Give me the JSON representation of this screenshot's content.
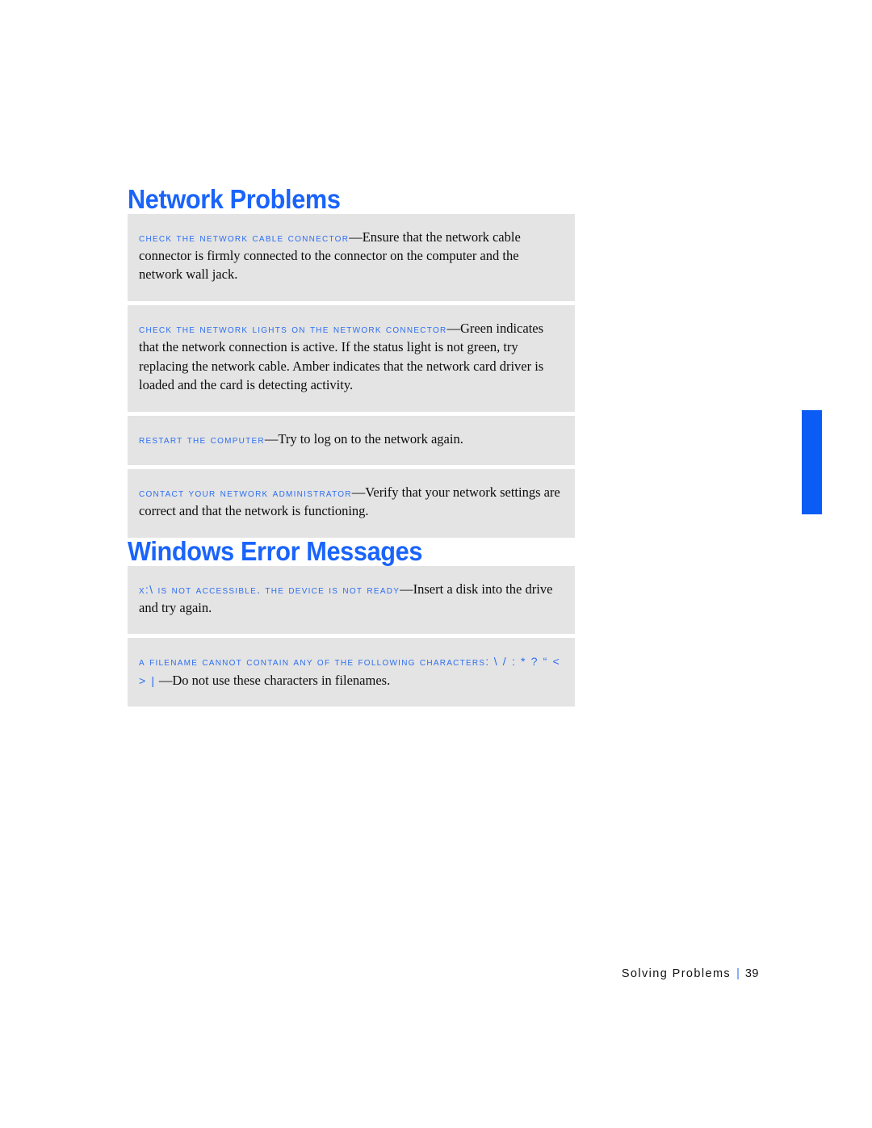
{
  "page": {
    "footer_section": "Solving Problems",
    "footer_separator": "|",
    "page_number": "39",
    "accent_color": "#1a64fb",
    "lead_color": "#2d6ef0",
    "box_color": "#e4e4e4",
    "tab_color": "#0a5cf5"
  },
  "sections": [
    {
      "heading": "Network Problems",
      "tips": [
        {
          "lead": "CHECK THE NETWORK CABLE CONNECTOR",
          "dash": "—",
          "body": "Ensure that the network cable connector is firmly connected to the connector on the computer and the network wall jack."
        },
        {
          "lead": "CHECK THE NETWORK LIGHTS ON THE NETWORK CONNECTOR",
          "dash": "—",
          "body": "Green indicates that the network connection is active. If the status light is not green, try replacing the network cable. Amber indicates that the network card driver is loaded and the card is detecting activity."
        },
        {
          "lead": "RESTART THE COMPUTER",
          "dash": "—",
          "body": "Try to log on to the network again."
        },
        {
          "lead": "CONTACT YOUR NETWORK ADMINISTRATOR",
          "dash": "—",
          "body": "Verify that your network settings are correct and that the network is functioning."
        }
      ]
    },
    {
      "heading": "Windows Error Messages",
      "tips": [
        {
          "lead": "X:\\ IS NOT ACCESSIBLE. THE DEVICE IS NOT READY",
          "dash": "—",
          "body": "Insert a disk into the drive and try again."
        },
        {
          "lead": "A FILENAME CANNOT CONTAIN ANY OF THE FOLLOWING CHARACTERS: ",
          "lead_symbols": "\\ / : * ? “  <  >  |",
          "dash": " —",
          "body": "Do not use these characters in filenames."
        }
      ]
    }
  ]
}
